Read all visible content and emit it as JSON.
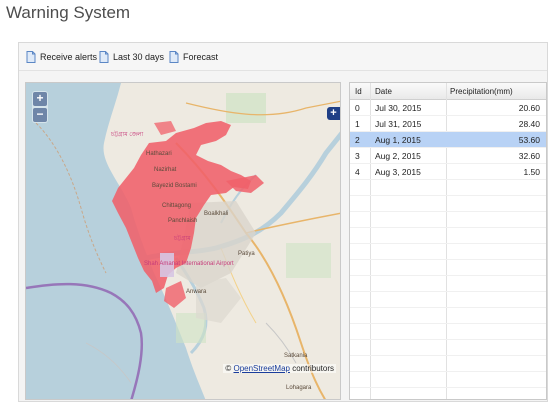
{
  "app": {
    "title": "Warning System"
  },
  "toolbar": {
    "buttons": [
      {
        "label": "Receive alerts",
        "icon": "document-icon"
      },
      {
        "label": "Last 30 days",
        "icon": "document-icon"
      },
      {
        "label": "Forecast",
        "icon": "document-icon"
      }
    ]
  },
  "map": {
    "zoom_in": "+",
    "zoom_out": "−",
    "layer_switcher": "+",
    "attribution_prefix": "©",
    "attribution_link": "OpenStreetMap",
    "attribution_suffix": "contributors",
    "labels": {
      "hathazari": "Hathazari",
      "nazirhat": "Nazirhat",
      "bayezid": "Bayezid Bostami",
      "chittagong_en": "Chittagong",
      "panchlaish": "Panchlaish",
      "boalkhali": "Boalkhali",
      "patiya": "Patiya",
      "anwara": "Anwara",
      "satkania": "Satkania",
      "lohagara": "Lohagara",
      "airport": "Shah Amanat International Airport"
    },
    "colors": {
      "flood_overlay": "#f0606a",
      "water": "#b7d0dc",
      "land": "#eeeae1"
    }
  },
  "grid": {
    "columns": [
      "Id",
      "Date",
      "Precipitation(mm)"
    ],
    "rows": [
      {
        "id": "0",
        "date": "Jul 30, 2015",
        "precip": "20.60",
        "selected": false
      },
      {
        "id": "1",
        "date": "Jul 31, 2015",
        "precip": "28.40",
        "selected": false
      },
      {
        "id": "2",
        "date": "Aug 1, 2015",
        "precip": "53.60",
        "selected": true
      },
      {
        "id": "3",
        "date": "Aug 2, 2015",
        "precip": "32.60",
        "selected": false
      },
      {
        "id": "4",
        "date": "Aug 3, 2015",
        "precip": "1.50",
        "selected": false
      }
    ],
    "colors": {
      "selected_row": "#b8d2f5"
    }
  }
}
